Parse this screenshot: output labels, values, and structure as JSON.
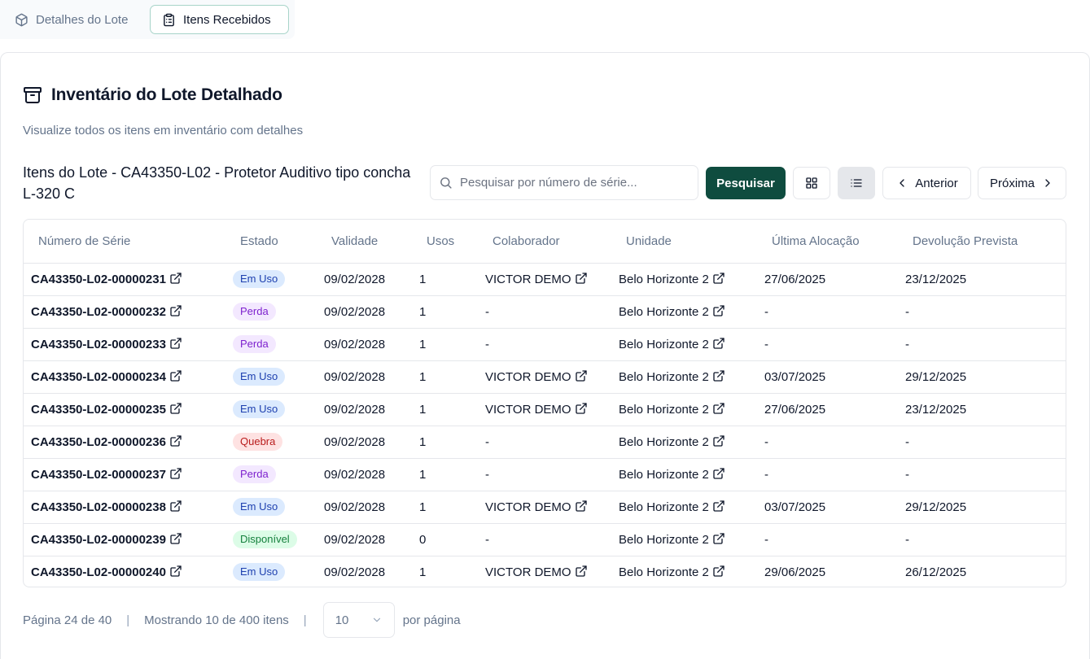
{
  "tabs": [
    {
      "label": "Detalhes do Lote",
      "icon": "box-icon"
    },
    {
      "label": "Itens Recebidos",
      "icon": "clipboard-list-icon"
    }
  ],
  "card": {
    "title": "Inventário do Lote Detalhado",
    "subtitle": "Visualize todos os itens em inventário com detalhes",
    "list_title": "Itens do Lote - CA43350-L02 - Protetor Auditivo tipo concha L-320 C"
  },
  "toolbar": {
    "search_placeholder": "Pesquisar por número de série...",
    "search_button": "Pesquisar",
    "prev_label": "Anterior",
    "next_label": "Próxima"
  },
  "table": {
    "headers": [
      "Número de Série",
      "Estado",
      "Validade",
      "Usos",
      "Colaborador",
      "Unidade",
      "Última Alocação",
      "Devolução Prevista"
    ],
    "rows": [
      {
        "serial": "CA43350-L02-00000231",
        "estado": "Em Uso",
        "validade": "09/02/2028",
        "usos": "1",
        "colaborador": "VICTOR DEMO",
        "unidade": "Belo Horizonte 2",
        "ultima": "27/06/2025",
        "devolucao": "23/12/2025"
      },
      {
        "serial": "CA43350-L02-00000232",
        "estado": "Perda",
        "validade": "09/02/2028",
        "usos": "1",
        "colaborador": "-",
        "unidade": "Belo Horizonte 2",
        "ultima": "-",
        "devolucao": "-"
      },
      {
        "serial": "CA43350-L02-00000233",
        "estado": "Perda",
        "validade": "09/02/2028",
        "usos": "1",
        "colaborador": "-",
        "unidade": "Belo Horizonte 2",
        "ultima": "-",
        "devolucao": "-"
      },
      {
        "serial": "CA43350-L02-00000234",
        "estado": "Em Uso",
        "validade": "09/02/2028",
        "usos": "1",
        "colaborador": "VICTOR DEMO",
        "unidade": "Belo Horizonte 2",
        "ultima": "03/07/2025",
        "devolucao": "29/12/2025"
      },
      {
        "serial": "CA43350-L02-00000235",
        "estado": "Em Uso",
        "validade": "09/02/2028",
        "usos": "1",
        "colaborador": "VICTOR DEMO",
        "unidade": "Belo Horizonte 2",
        "ultima": "27/06/2025",
        "devolucao": "23/12/2025"
      },
      {
        "serial": "CA43350-L02-00000236",
        "estado": "Quebra",
        "validade": "09/02/2028",
        "usos": "1",
        "colaborador": "-",
        "unidade": "Belo Horizonte 2",
        "ultima": "-",
        "devolucao": "-"
      },
      {
        "serial": "CA43350-L02-00000237",
        "estado": "Perda",
        "validade": "09/02/2028",
        "usos": "1",
        "colaborador": "-",
        "unidade": "Belo Horizonte 2",
        "ultima": "-",
        "devolucao": "-"
      },
      {
        "serial": "CA43350-L02-00000238",
        "estado": "Em Uso",
        "validade": "09/02/2028",
        "usos": "1",
        "colaborador": "VICTOR DEMO",
        "unidade": "Belo Horizonte 2",
        "ultima": "03/07/2025",
        "devolucao": "29/12/2025"
      },
      {
        "serial": "CA43350-L02-00000239",
        "estado": "Disponível",
        "validade": "09/02/2028",
        "usos": "0",
        "colaborador": "-",
        "unidade": "Belo Horizonte 2",
        "ultima": "-",
        "devolucao": "-"
      },
      {
        "serial": "CA43350-L02-00000240",
        "estado": "Em Uso",
        "validade": "09/02/2028",
        "usos": "1",
        "colaborador": "VICTOR DEMO",
        "unidade": "Belo Horizonte 2",
        "ultima": "29/06/2025",
        "devolucao": "26/12/2025"
      }
    ]
  },
  "status_colors": {
    "Em Uso": "#1e40af",
    "Perda": "#7e22ce",
    "Quebra": "#b91c1c",
    "Disponível": "#15803d"
  },
  "footer": {
    "page_info": "Página 24 de 40",
    "showing_info": "Mostrando 10 de 400 itens",
    "page_size": "10",
    "per_page_label": "por página"
  },
  "accent_color": "#0f4c3f"
}
